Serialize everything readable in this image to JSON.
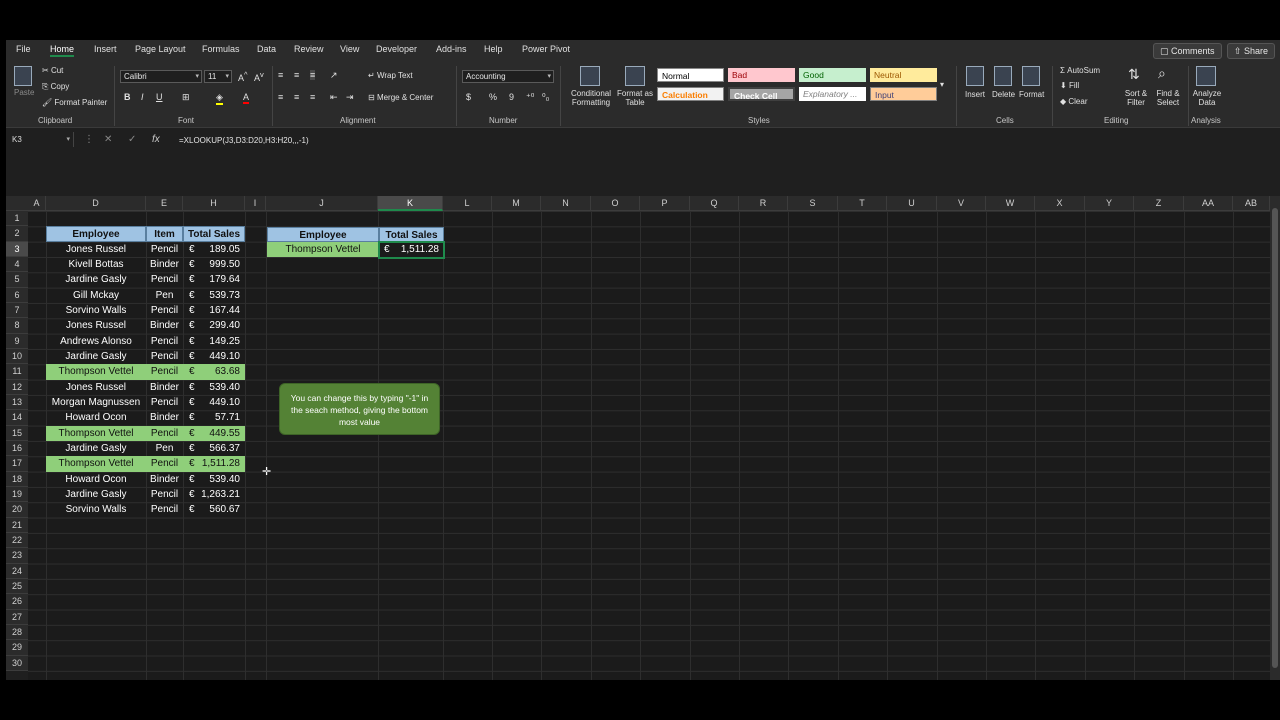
{
  "menu": {
    "tabs": [
      "File",
      "Home",
      "Insert",
      "Page Layout",
      "Formulas",
      "Data",
      "Review",
      "View",
      "Developer",
      "Add-ins",
      "Help",
      "Power Pivot"
    ],
    "comments": "Comments",
    "share": "Share"
  },
  "ribbon": {
    "clipboard": {
      "paste": "Paste",
      "cut": "Cut",
      "copy": "Copy",
      "format_painter": "Format Painter",
      "label": "Clipboard"
    },
    "font": {
      "name": "Calibri",
      "size": "11",
      "label": "Font"
    },
    "alignment": {
      "wrap": "Wrap Text",
      "merge": "Merge & Center",
      "label": "Alignment"
    },
    "number": {
      "format": "Accounting",
      "currency": "$",
      "percent": "%",
      "comma": "9",
      "label": "Number"
    },
    "styles": {
      "cond": "Conditional Formatting",
      "table": "Format as Table",
      "label": "Styles",
      "items": [
        {
          "label": "Normal",
          "bg": "#ffffff",
          "fg": "#000000"
        },
        {
          "label": "Bad",
          "bg": "#ffc7ce",
          "fg": "#9c0006"
        },
        {
          "label": "Good",
          "bg": "#c6efce",
          "fg": "#006100"
        },
        {
          "label": "Neutral",
          "bg": "#ffeb9c",
          "fg": "#9c5700"
        },
        {
          "label": "Calculation",
          "bg": "#f2f2f2",
          "fg": "#fa7d00"
        },
        {
          "label": "Check Cell",
          "bg": "#a5a5a5",
          "fg": "#ffffff"
        },
        {
          "label": "Explanatory ...",
          "bg": "#ffffff",
          "fg": "#7f7f7f"
        },
        {
          "label": "Input",
          "bg": "#ffcc99",
          "fg": "#3f3f76"
        }
      ]
    },
    "cells": {
      "insert": "Insert",
      "delete": "Delete",
      "format": "Format",
      "label": "Cells"
    },
    "editing": {
      "autosum": "AutoSum",
      "fill": "Fill",
      "clear": "Clear",
      "sort": "Sort & Filter",
      "find": "Find & Select",
      "label": "Editing"
    },
    "analysis": {
      "analyze": "Analyze Data",
      "label": "Analysis"
    }
  },
  "formula_bar": {
    "name_box": "K3",
    "formula": "=XLOOKUP(J3,D3:D20,H3:H20,,,-1)"
  },
  "columns": [
    "A",
    "D",
    "E",
    "H",
    "I",
    "J",
    "K",
    "L",
    "M",
    "N",
    "O",
    "P",
    "Q",
    "R",
    "S",
    "T",
    "U",
    "V",
    "W",
    "X",
    "Y",
    "Z",
    "AA",
    "AB"
  ],
  "rows": [
    "1",
    "2",
    "3",
    "4",
    "5",
    "6",
    "7",
    "8",
    "9",
    "10",
    "11",
    "12",
    "13",
    "14",
    "15",
    "16",
    "17",
    "18",
    "19",
    "20",
    "21",
    "22",
    "23",
    "24",
    "25",
    "26",
    "27",
    "28",
    "29",
    "30"
  ],
  "table": {
    "headers": [
      "Employee",
      "Item",
      "Total Sales"
    ],
    "currency": "€",
    "data": [
      {
        "employee": "Jones Russel",
        "item": "Pencil",
        "sales": "189.05",
        "hl": false
      },
      {
        "employee": "Kivell Bottas",
        "item": "Binder",
        "sales": "999.50",
        "hl": false
      },
      {
        "employee": "Jardine Gasly",
        "item": "Pencil",
        "sales": "179.64",
        "hl": false
      },
      {
        "employee": "Gill Mckay",
        "item": "Pen",
        "sales": "539.73",
        "hl": false
      },
      {
        "employee": "Sorvino Walls",
        "item": "Pencil",
        "sales": "167.44",
        "hl": false
      },
      {
        "employee": "Jones Russel",
        "item": "Binder",
        "sales": "299.40",
        "hl": false
      },
      {
        "employee": "Andrews Alonso",
        "item": "Pencil",
        "sales": "149.25",
        "hl": false
      },
      {
        "employee": "Jardine Gasly",
        "item": "Pencil",
        "sales": "449.10",
        "hl": false
      },
      {
        "employee": "Thompson Vettel",
        "item": "Pencil",
        "sales": "63.68",
        "hl": true
      },
      {
        "employee": "Jones Russel",
        "item": "Binder",
        "sales": "539.40",
        "hl": false
      },
      {
        "employee": "Morgan Magnussen",
        "item": "Pencil",
        "sales": "449.10",
        "hl": false
      },
      {
        "employee": "Howard Ocon",
        "item": "Binder",
        "sales": "57.71",
        "hl": false
      },
      {
        "employee": "Thompson Vettel",
        "item": "Pencil",
        "sales": "449.55",
        "hl": true
      },
      {
        "employee": "Jardine Gasly",
        "item": "Pen",
        "sales": "566.37",
        "hl": false
      },
      {
        "employee": "Thompson Vettel",
        "item": "Pencil",
        "sales": "1,511.28",
        "hl": true
      },
      {
        "employee": "Howard Ocon",
        "item": "Binder",
        "sales": "539.40",
        "hl": false
      },
      {
        "employee": "Jardine Gasly",
        "item": "Pencil",
        "sales": "1,263.21",
        "hl": false
      },
      {
        "employee": "Sorvino Walls",
        "item": "Pencil",
        "sales": "560.67",
        "hl": false
      }
    ]
  },
  "lookup": {
    "h_employee": "Employee",
    "h_sales": "Total Sales",
    "employee": "Thompson Vettel",
    "currency": "€",
    "sales": "1,511.28"
  },
  "note": "You can change this by typing \"-1\" in the seach method, giving the bottom most value"
}
